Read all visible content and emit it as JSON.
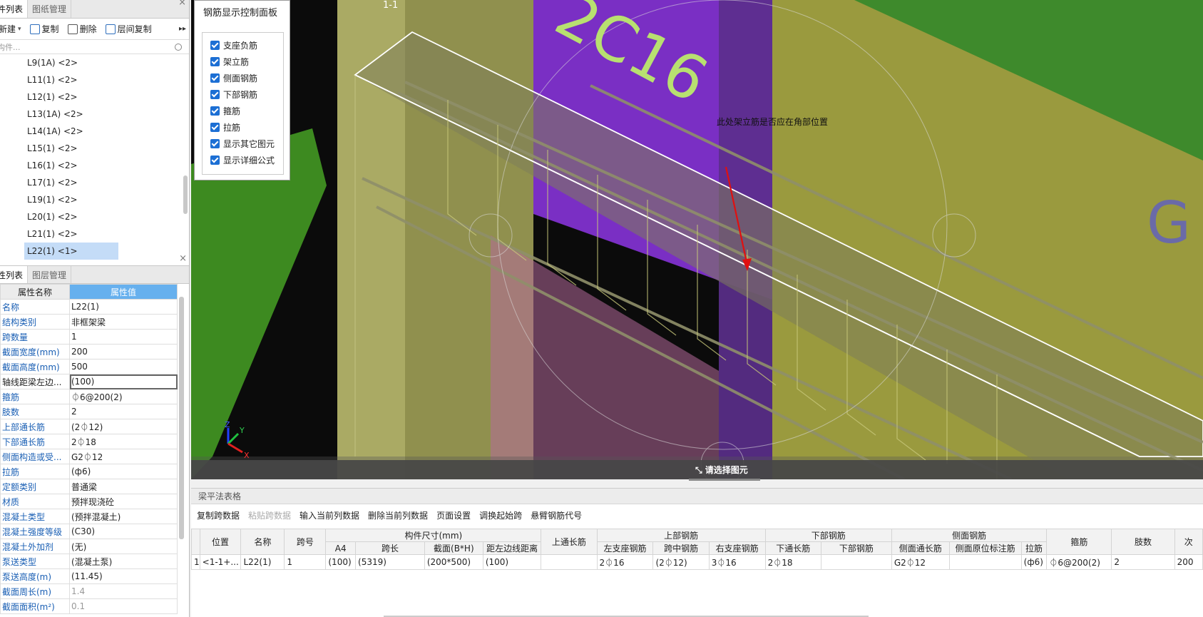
{
  "left_panel": {
    "tabs": [
      "件列表",
      "图纸管理"
    ],
    "toolbar": {
      "new": "新建",
      "copy": "复制",
      "delete": "删除",
      "floor_copy": "层间复制"
    },
    "search_placeholder": "构件...",
    "tree_items": [
      "L9(1A) <2>",
      "L11(1) <2>",
      "L12(1) <2>",
      "L13(1A) <2>",
      "L14(1A) <2>",
      "L15(1) <2>",
      "L16(1) <2>",
      "L17(1) <2>",
      "L19(1) <2>",
      "L20(1) <2>",
      "L21(1) <2>",
      "L22(1) <1>"
    ],
    "props_tabs": [
      "性列表",
      "图层管理"
    ],
    "props_header": {
      "name": "属性名称",
      "value": "属性值"
    },
    "props": [
      {
        "name": "名称",
        "value": "L22(1)"
      },
      {
        "name": "结构类别",
        "value": "非框架梁"
      },
      {
        "name": "跨数量",
        "value": "1"
      },
      {
        "name": "截面宽度(mm)",
        "value": "200"
      },
      {
        "name": "截面高度(mm)",
        "value": "500"
      },
      {
        "name": "轴线距梁左边...",
        "value": "(100)"
      },
      {
        "name": "箍筋",
        "value": "⏀6@200(2)"
      },
      {
        "name": "肢数",
        "value": "2"
      },
      {
        "name": "上部通长筋",
        "value": "(2⏀12)"
      },
      {
        "name": "下部通长筋",
        "value": "2⏀18"
      },
      {
        "name": "侧面构造或受...",
        "value": "G2⏀12"
      },
      {
        "name": "拉筋",
        "value": "(ф6)"
      },
      {
        "name": "定额类别",
        "value": "普通梁"
      },
      {
        "name": "材质",
        "value": "预拌现浇砼"
      },
      {
        "name": "混凝土类型",
        "value": "(预拌混凝土)"
      },
      {
        "name": "混凝土强度等级",
        "value": "(C30)"
      },
      {
        "name": "混凝土外加剂",
        "value": "(无)"
      },
      {
        "name": "泵送类型",
        "value": "(混凝土泵)"
      },
      {
        "name": "泵送高度(m)",
        "value": "(11.45)"
      },
      {
        "name": "截面周长(m)",
        "value": "1.4"
      },
      {
        "name": "截面面积(m²)",
        "value": "0.1"
      }
    ]
  },
  "control_panel": {
    "title": "钢筋显示控制面板",
    "options": [
      "支座负筋",
      "架立筋",
      "侧面钢筋",
      "下部钢筋",
      "箍筋",
      "拉筋",
      "显示其它图元",
      "显示详细公式"
    ]
  },
  "viewport": {
    "section_label": "1-1",
    "rebar_label": "2C16",
    "annotation": "此处架立筋是否应在角部位置",
    "status": "请选择图元",
    "axes": [
      "Z",
      "Y",
      "X"
    ],
    "colors": {
      "purple": "#7a2fc4",
      "olive": "#9a9a3e",
      "green": "#3e8a2c"
    }
  },
  "bottom_panel": {
    "title": "梁平法表格",
    "tools": [
      "复制跨数据",
      "粘贴跨数据",
      "输入当前列数据",
      "删除当前列数据",
      "页面设置",
      "调换起始跨",
      "悬臂钢筋代号"
    ],
    "header_groups": {
      "position": "位置",
      "name": "名称",
      "span_no": "跨号",
      "size": "构件尺寸(mm)",
      "top_through": "上通长筋",
      "top_rebar": "上部钢筋",
      "bottom_rebar": "下部钢筋",
      "side_rebar": "侧面钢筋",
      "stirrup": "箍筋",
      "legs": "肢数",
      "next": "次"
    },
    "sub_headers": [
      "A4",
      "跨长",
      "截面(B*H)",
      "距左边线距离",
      "左支座钢筋",
      "跨中钢筋",
      "右支座钢筋",
      "下通长筋",
      "下部钢筋",
      "侧面通长筋",
      "侧面原位标注筋",
      "拉筋"
    ],
    "row": {
      "index": "1",
      "position": "<1-1+...",
      "name": "L22(1)",
      "span": "1",
      "a4": "(100)",
      "span_len": "(5319)",
      "section": "(200*500)",
      "dist_left": "(100)",
      "top_through": "",
      "left_seat": "2⏀16",
      "mid": "(2⏀12)",
      "right_seat": "3⏀16",
      "bottom_through": "2⏀18",
      "bottom": "",
      "side_through": "G2⏀12",
      "side_in_situ": "",
      "tie": "(ф6)",
      "stirrup": "⏀6@200(2)",
      "legs": "2",
      "next": "200"
    }
  }
}
